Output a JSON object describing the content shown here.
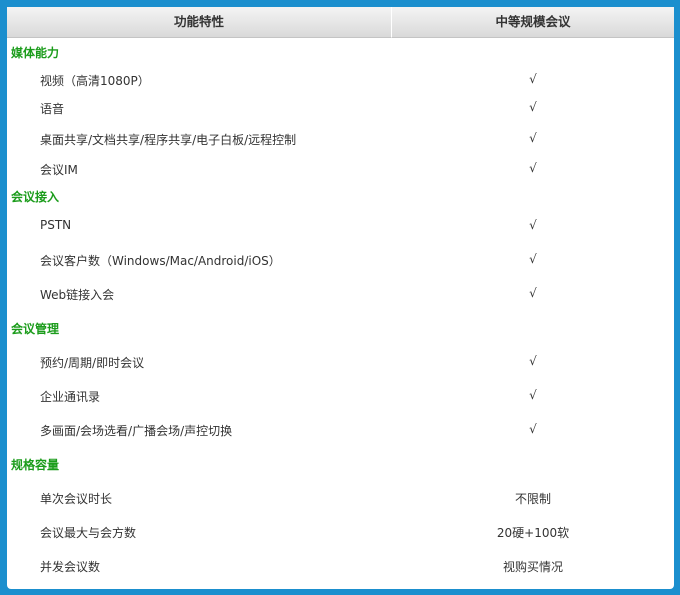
{
  "header": {
    "feature": "功能特性",
    "value": "中等规模会议"
  },
  "sections": [
    {
      "title": "媒体能力",
      "rows": [
        {
          "feature": "视频（高清1080P）",
          "value": "√"
        },
        {
          "feature": "语音",
          "value": "√"
        },
        {
          "feature": "桌面共享/文档共享/程序共享/电子白板/远程控制",
          "value": "√"
        },
        {
          "feature": "会议IM",
          "value": "√"
        }
      ]
    },
    {
      "title": "会议接入",
      "rows": [
        {
          "feature": "PSTN",
          "value": "√"
        },
        {
          "feature": "会议客户数（Windows/Mac/Android/iOS）",
          "value": "√"
        },
        {
          "feature": "Web链接入会",
          "value": "√"
        }
      ]
    },
    {
      "title": "会议管理",
      "rows": [
        {
          "feature": "预约/周期/即时会议",
          "value": "√"
        },
        {
          "feature": "企业通讯录",
          "value": "√"
        },
        {
          "feature": "多画面/会场选看/广播会场/声控切换",
          "value": "√"
        }
      ]
    },
    {
      "title": "规格容量",
      "rows": [
        {
          "feature": "单次会议时长",
          "value": "不限制"
        },
        {
          "feature": "会议最大与会方数",
          "value": "20硬+100软"
        },
        {
          "feature": "并发会议数",
          "value": "视购买情况"
        }
      ]
    }
  ]
}
